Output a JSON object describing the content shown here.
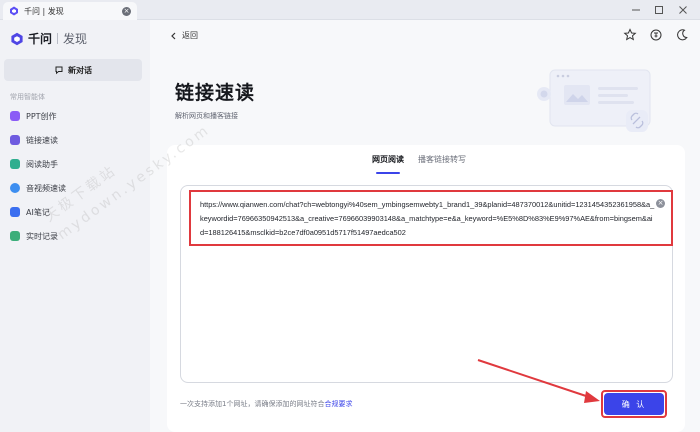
{
  "window": {
    "tab_title": "千问 | 发现",
    "tab_close_label": "×",
    "controls": [
      "minimize",
      "maximize",
      "close"
    ]
  },
  "sidebar": {
    "brand_name": "千问",
    "brand_sub": "发现",
    "new_chat_label": "新对话",
    "section_label": "常用智能体",
    "items": [
      {
        "label": "PPT创作",
        "icon": "ppt-icon",
        "color": "#8b5cf6"
      },
      {
        "label": "链接速读",
        "icon": "link-icon",
        "color": "#6f5ce0"
      },
      {
        "label": "阅读助手",
        "icon": "reader-icon",
        "color": "#2fae8f"
      },
      {
        "label": "音视频速读",
        "icon": "media-icon",
        "color": "#3d8ef0"
      },
      {
        "label": "AI笔记",
        "icon": "note-icon",
        "color": "#3b6ff0"
      },
      {
        "label": "实时记录",
        "icon": "record-icon",
        "color": "#3cae7a"
      }
    ]
  },
  "main": {
    "back_label": "返回",
    "title": "链接速读",
    "subtitle": "解析网页和播客链接",
    "tabs": [
      {
        "label": "网页阅读",
        "active": true
      },
      {
        "label": "播客链接转写",
        "active": false
      }
    ],
    "url_value": "https://www.qianwen.com/chat?ch=webtongyi%40sem_ymbingsemwebty1_brand1_39&planid=487370012&unitid=1231454352361958&a_keywordid=76966350942513&a_creative=76966039903148&a_matchtype=e&a_keyword=%E5%8D%83%E9%97%AE&from=bingsem&aid=188126415&msclkid=b2ce7df0a0951d5717f51497aedca502",
    "clear_label": "×",
    "hint_text": "一次支持添加1个网址，请确保添加的网址符合",
    "hint_link": "合规要求",
    "confirm_label": "确 认",
    "accent_color": "#3b44e9",
    "highlight_color": "#e0393e"
  },
  "watermark": {
    "line1": "天极下载站",
    "line2": "mydown.yesky.com"
  }
}
